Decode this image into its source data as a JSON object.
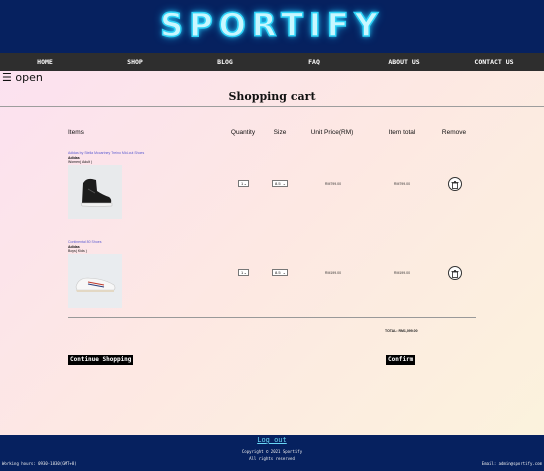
{
  "brand": {
    "logo": "SPORTIFY"
  },
  "nav": {
    "items": [
      "HOME",
      "SHOP",
      "BLOG",
      "FAQ",
      "ABOUT US",
      "CONTACT US"
    ]
  },
  "menu_toggle": {
    "label": "☰ open"
  },
  "page": {
    "title": "Shopping cart"
  },
  "table": {
    "headers": {
      "items": "Items",
      "quantity": "Quantity",
      "size": "Size",
      "unit_price": "Unit Price(RM)",
      "item_total": "Item total",
      "remove": "Remove"
    }
  },
  "cart": [
    {
      "name": "Adidas by Stella Mccartney Treino Mid-cut Shoes",
      "brand": "Adidas",
      "category": "Women( Adult )",
      "quantity": "1",
      "size": "8.5",
      "unit_price": "RM799.00",
      "item_total": "RM799.00"
    },
    {
      "name": "Continental 80 Shoes",
      "brand": "Adidas",
      "category": "Boys( Kids )",
      "quantity": "1",
      "size": "8.5",
      "unit_price": "RM199.00",
      "item_total": "RM199.00"
    }
  ],
  "summary": {
    "total": "TOTAL: RM1,099.00"
  },
  "actions": {
    "continue": "Continue Shopping",
    "confirm": "Confirm"
  },
  "footer": {
    "logout": "Log out",
    "copyright": "Copyright © 2021 Sportify",
    "rights": "All rights reserved",
    "hours": "Working hours: 0930-1830(GMT+8)",
    "email": "Email: admin@sportify.com"
  },
  "colors": {
    "header_bg": "#06215f",
    "nav_bg": "#2e2e2e",
    "logo_glow": "#2fd3f7",
    "link": "#5a5ad0"
  }
}
